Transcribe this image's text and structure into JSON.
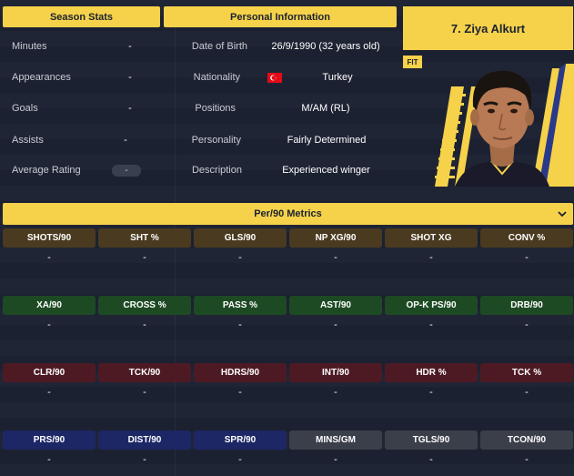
{
  "season_stats": {
    "title": "Season Stats",
    "rows": [
      {
        "label": "Minutes",
        "value": "-"
      },
      {
        "label": "Appearances",
        "value": "-"
      },
      {
        "label": "Goals",
        "value": "-"
      },
      {
        "label": "Assists",
        "value": "-"
      },
      {
        "label": "Average Rating",
        "value": "-"
      }
    ]
  },
  "personal_info": {
    "title": "Personal Information",
    "rows": [
      {
        "label": "Date of Birth",
        "value": "26/9/1990 (32 years old)"
      },
      {
        "label": "Nationality",
        "value": "Turkey",
        "flag_icon": "turkey-flag-icon"
      },
      {
        "label": "Positions",
        "value": "M/AM (RL)"
      },
      {
        "label": "Personality",
        "value": "Fairly Determined"
      },
      {
        "label": "Description",
        "value": "Experienced winger"
      }
    ]
  },
  "player": {
    "name": "7. Ziya Alkurt",
    "fit_badge": "FIT"
  },
  "metrics": {
    "title": "Per/90 Metrics",
    "rows": [
      {
        "color": "brown",
        "tiles": [
          {
            "label": "SHOTS/90",
            "value": "-"
          },
          {
            "label": "SHT %",
            "value": "-"
          },
          {
            "label": "GLS/90",
            "value": "-"
          },
          {
            "label": "NP XG/90",
            "value": "-"
          },
          {
            "label": "SHOT XG",
            "value": "-"
          },
          {
            "label": "CONV %",
            "value": "-"
          }
        ]
      },
      {
        "color": "green",
        "tiles": [
          {
            "label": "XA/90",
            "value": "-"
          },
          {
            "label": "CROSS %",
            "value": "-"
          },
          {
            "label": "PASS %",
            "value": "-"
          },
          {
            "label": "AST/90",
            "value": "-"
          },
          {
            "label": "OP-K PS/90",
            "value": "-"
          },
          {
            "label": "DRB/90",
            "value": "-"
          }
        ]
      },
      {
        "color": "red",
        "tiles": [
          {
            "label": "CLR/90",
            "value": "-"
          },
          {
            "label": "TCK/90",
            "value": "-"
          },
          {
            "label": "HDRS/90",
            "value": "-"
          },
          {
            "label": "INT/90",
            "value": "-"
          },
          {
            "label": "HDR %",
            "value": "-"
          },
          {
            "label": "TCK %",
            "value": "-"
          }
        ]
      },
      {
        "color": "mixed",
        "tiles": [
          {
            "label": "PRS/90",
            "value": "-"
          },
          {
            "label": "DIST/90",
            "value": "-"
          },
          {
            "label": "SPR/90",
            "value": "-"
          },
          {
            "label": "MINS/GM",
            "value": "-"
          },
          {
            "label": "TGLS/90",
            "value": "-"
          },
          {
            "label": "TCON/90",
            "value": "-"
          }
        ]
      }
    ]
  },
  "colors": {
    "accent": "#f5d24a",
    "background": "#1c2131",
    "attacking": "#4a3a1f",
    "creating": "#1d4a23",
    "defending": "#4d1a24",
    "physical": "#1d2766",
    "neutral": "#3b3f4a"
  }
}
